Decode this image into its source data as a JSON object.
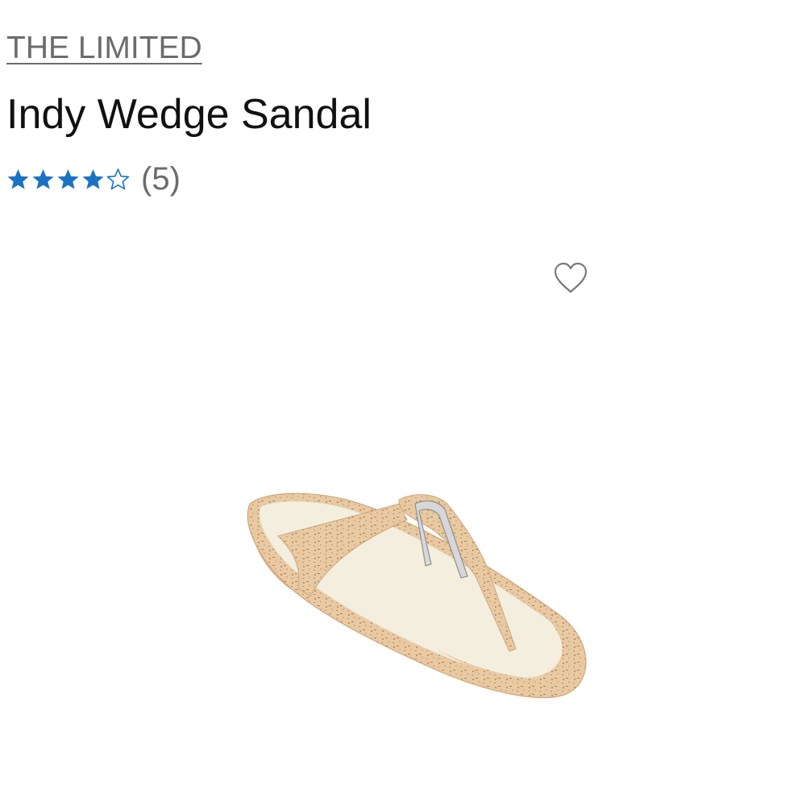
{
  "product": {
    "brand": "THE LIMITED",
    "name": "Indy Wedge Sandal",
    "rating": {
      "value": 4,
      "max": 5,
      "count_label": "(5)",
      "color": "#1a73c2"
    }
  },
  "image": {
    "subject": "cork wedge thong sandal"
  },
  "icons": {
    "favorite": "heart-outline-icon",
    "star_filled": "star-filled-icon",
    "star_empty": "star-outline-icon"
  }
}
